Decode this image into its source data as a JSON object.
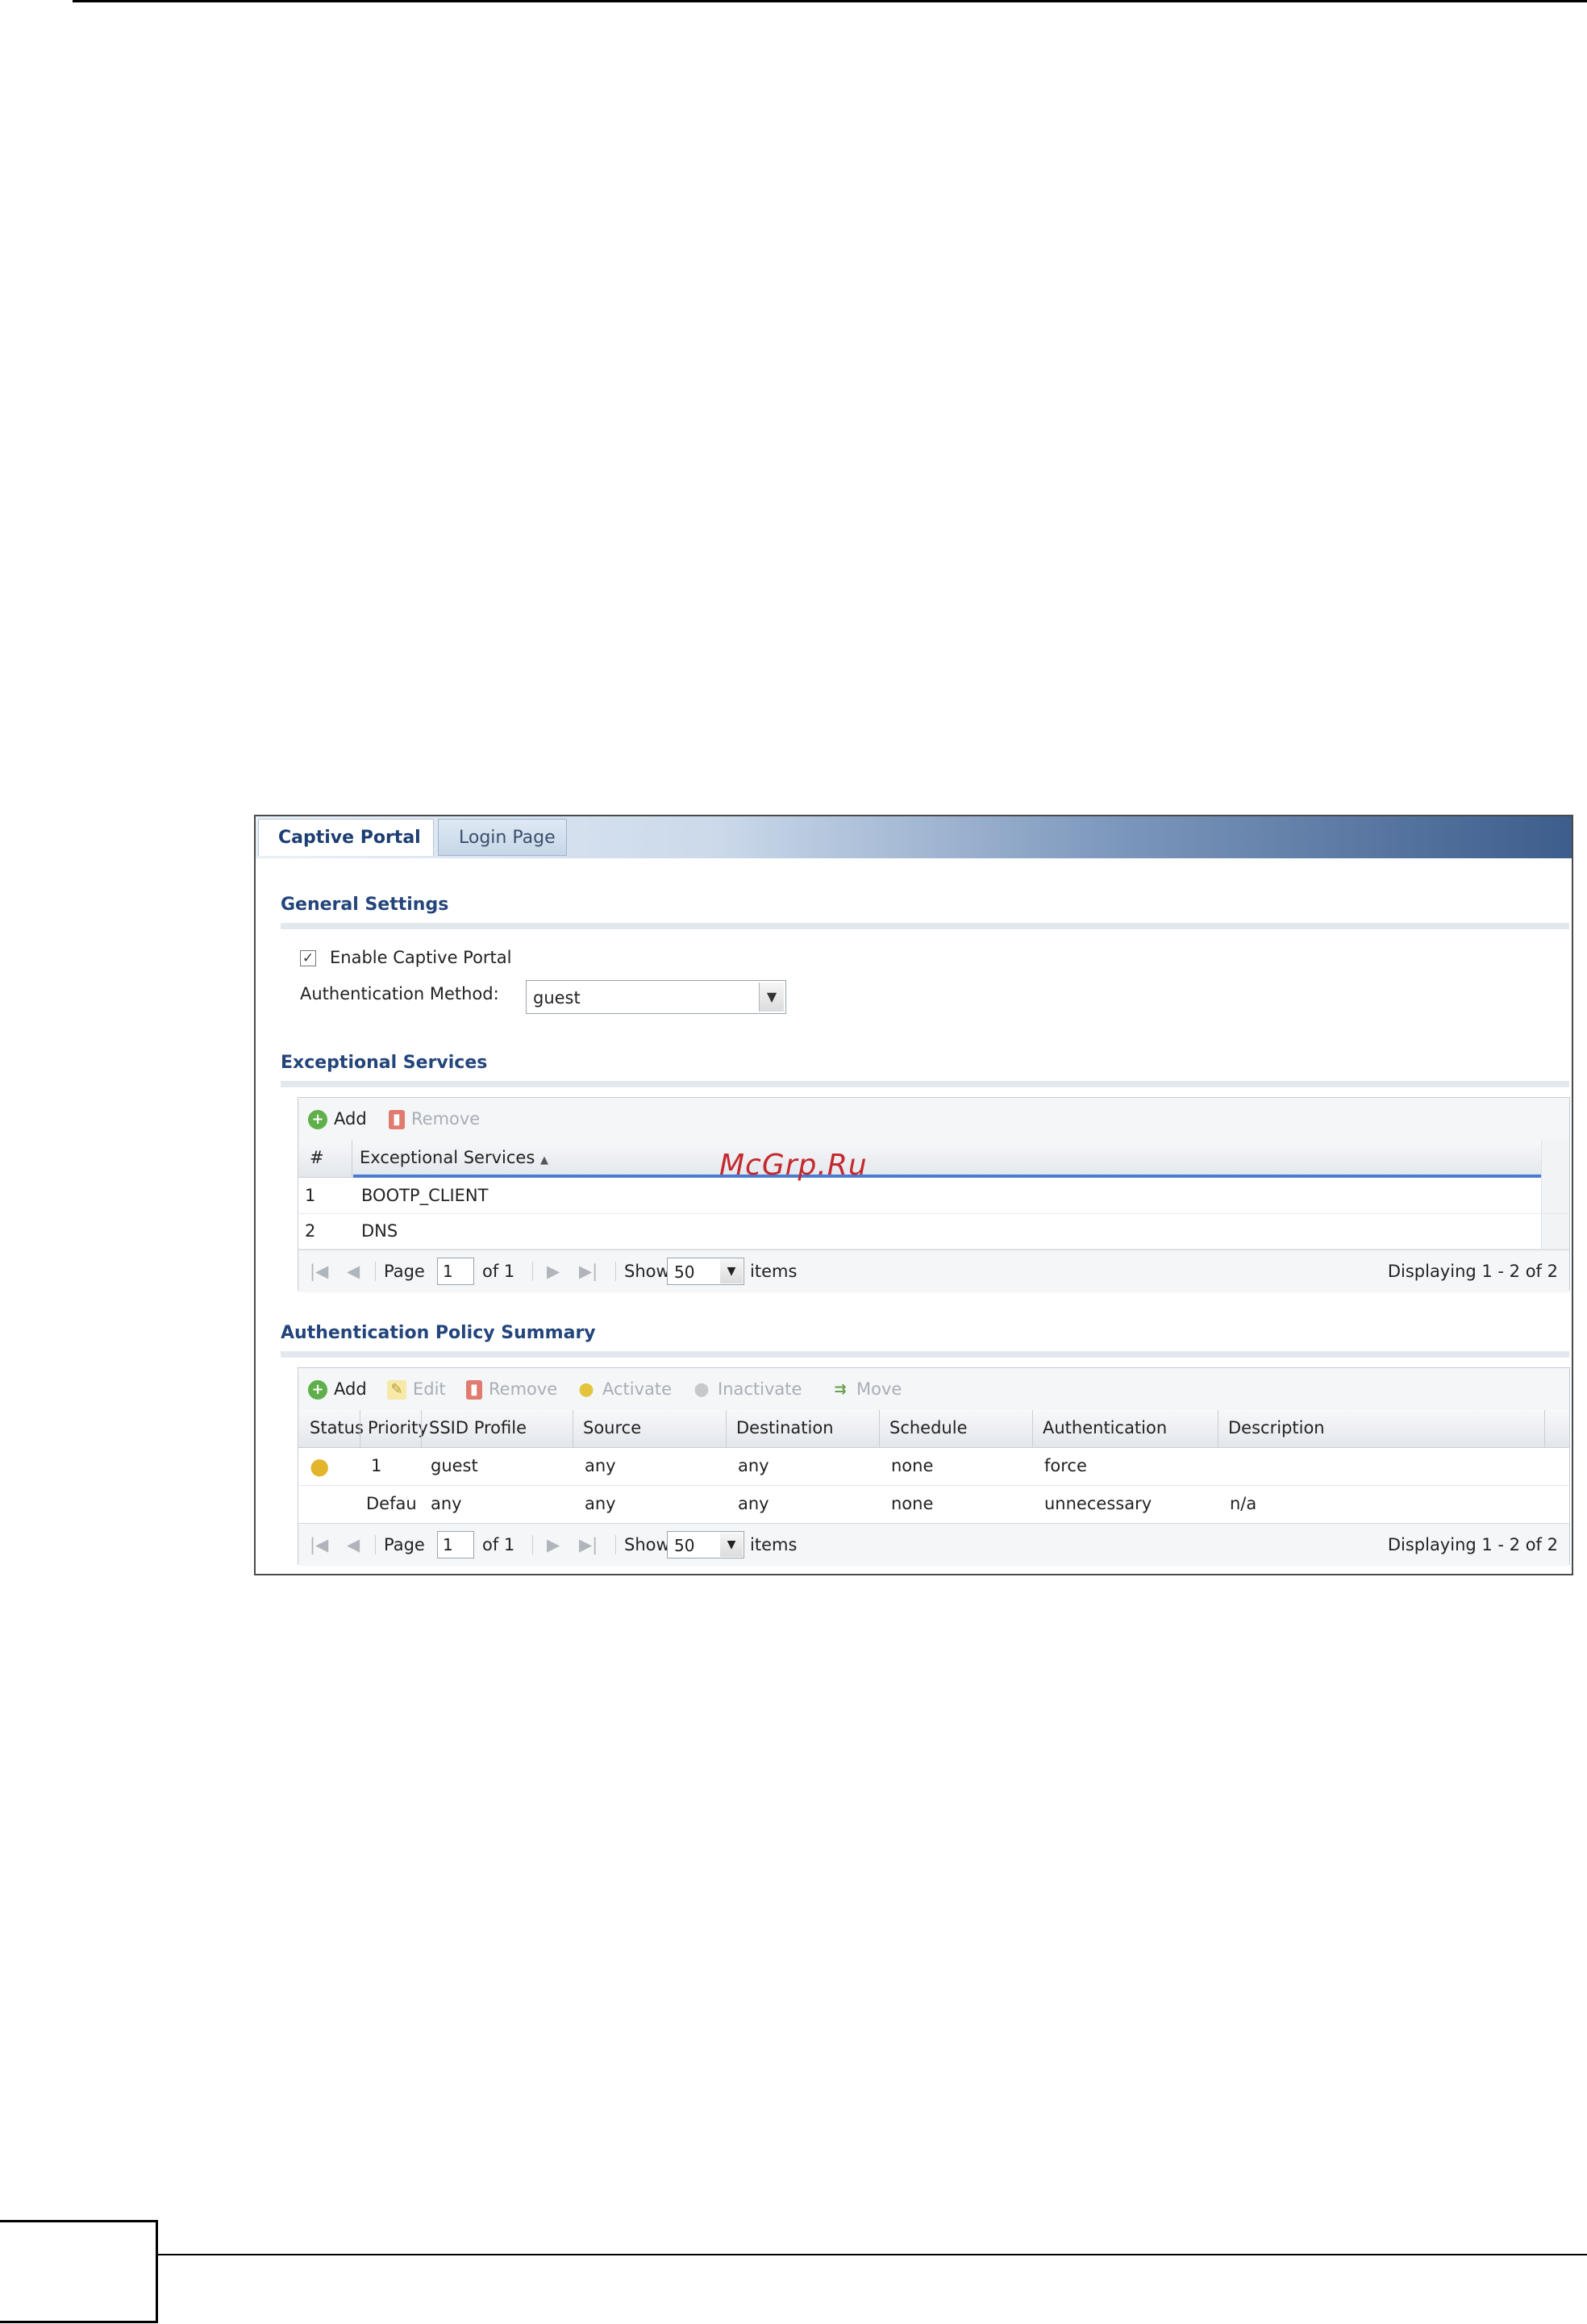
{
  "tabs": [
    {
      "label": "Captive Portal",
      "active": true
    },
    {
      "label": "Login Page",
      "active": false
    }
  ],
  "general": {
    "title": "General Settings",
    "enable_label": "Enable Captive Portal",
    "enable_checked": true,
    "auth_method_label": "Authentication Method:",
    "auth_method_value": "guest"
  },
  "exceptional": {
    "title": "Exceptional Services",
    "toolbar": {
      "add": "Add",
      "remove": "Remove"
    },
    "columns": [
      "#",
      "Exceptional Services"
    ],
    "rows": [
      {
        "num": "1",
        "service": "BOOTP_CLIENT"
      },
      {
        "num": "2",
        "service": "DNS"
      }
    ],
    "pager": {
      "page_label": "Page",
      "page": "1",
      "of": "of 1",
      "show": "Show",
      "items_value": "50",
      "items": "items",
      "displaying": "Displaying 1 - 2 of 2"
    }
  },
  "policy": {
    "title": "Authentication Policy Summary",
    "toolbar": {
      "add": "Add",
      "edit": "Edit",
      "remove": "Remove",
      "activate": "Activate",
      "inactivate": "Inactivate",
      "move": "Move"
    },
    "columns": [
      "Status",
      "Priority",
      "SSID Profile",
      "Source",
      "Destination",
      "Schedule",
      "Authentication",
      "Description"
    ],
    "rows": [
      {
        "priority": "1",
        "ssid": "guest",
        "source": "any",
        "destination": "any",
        "schedule": "none",
        "authentication": "force",
        "description": ""
      },
      {
        "priority": "Defau",
        "ssid": "any",
        "source": "any",
        "destination": "any",
        "schedule": "none",
        "authentication": "unnecessary",
        "description": "n/a"
      }
    ],
    "pager": {
      "page_label": "Page",
      "page": "1",
      "of": "of 1",
      "show": "Show",
      "items_value": "50",
      "items": "items",
      "displaying": "Displaying 1 - 2 of 2"
    }
  },
  "watermark": "McGrp.Ru"
}
